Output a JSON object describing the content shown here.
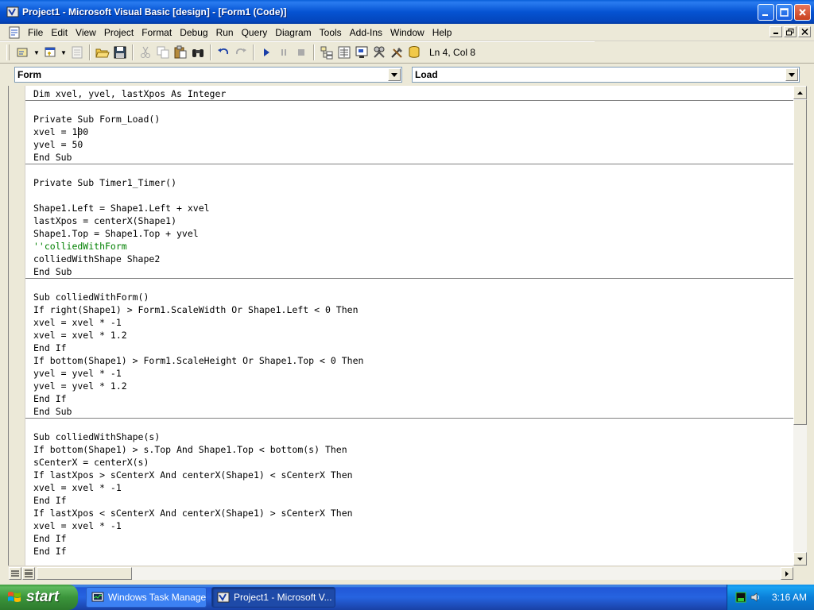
{
  "window": {
    "title": "Project1 - Microsoft Visual Basic [design] - [Form1 (Code)]"
  },
  "menu": {
    "items": [
      "File",
      "Edit",
      "View",
      "Project",
      "Format",
      "Debug",
      "Run",
      "Query",
      "Diagram",
      "Tools",
      "Add-Ins",
      "Window",
      "Help"
    ]
  },
  "toolbar": {
    "position_label": "Ln 4, Col 8"
  },
  "combos": {
    "object": "Form",
    "procedure": "Load"
  },
  "code": {
    "lines": [
      {
        "text": "Dim xvel, yvel, lastXpos As Integer",
        "comment": false
      },
      {
        "text": "",
        "comment": false
      },
      {
        "text": "Private Sub Form_Load()",
        "comment": false
      },
      {
        "text": "xvel = 100",
        "comment": false
      },
      {
        "text": "yvel = 50",
        "comment": false
      },
      {
        "text": "End Sub",
        "comment": false
      },
      {
        "text": "",
        "comment": false
      },
      {
        "text": "Private Sub Timer1_Timer()",
        "comment": false
      },
      {
        "text": "",
        "comment": false
      },
      {
        "text": "Shape1.Left = Shape1.Left + xvel",
        "comment": false
      },
      {
        "text": "lastXpos = centerX(Shape1)",
        "comment": false
      },
      {
        "text": "Shape1.Top = Shape1.Top + yvel",
        "comment": false
      },
      {
        "text": "''colliedWithForm",
        "comment": true
      },
      {
        "text": "colliedWithShape Shape2",
        "comment": false
      },
      {
        "text": "End Sub",
        "comment": false
      },
      {
        "text": "",
        "comment": false
      },
      {
        "text": "Sub colliedWithForm()",
        "comment": false
      },
      {
        "text": "If right(Shape1) > Form1.ScaleWidth Or Shape1.Left < 0 Then",
        "comment": false
      },
      {
        "text": "xvel = xvel * -1",
        "comment": false
      },
      {
        "text": "xvel = xvel * 1.2",
        "comment": false
      },
      {
        "text": "End If",
        "comment": false
      },
      {
        "text": "If bottom(Shape1) > Form1.ScaleHeight Or Shape1.Top < 0 Then",
        "comment": false
      },
      {
        "text": "yvel = yvel * -1",
        "comment": false
      },
      {
        "text": "yvel = yvel * 1.2",
        "comment": false
      },
      {
        "text": "End If",
        "comment": false
      },
      {
        "text": "End Sub",
        "comment": false
      },
      {
        "text": "",
        "comment": false
      },
      {
        "text": "Sub colliedWithShape(s)",
        "comment": false
      },
      {
        "text": "If bottom(Shape1) > s.Top And Shape1.Top < bottom(s) Then",
        "comment": false
      },
      {
        "text": "sCenterX = centerX(s)",
        "comment": false
      },
      {
        "text": "If lastXpos > sCenterX And centerX(Shape1) < sCenterX Then",
        "comment": false
      },
      {
        "text": "xvel = xvel * -1",
        "comment": false
      },
      {
        "text": "End If",
        "comment": false
      },
      {
        "text": "If lastXpos < sCenterX And centerX(Shape1) > sCenterX Then",
        "comment": false
      },
      {
        "text": "xvel = xvel * -1",
        "comment": false
      },
      {
        "text": "End If",
        "comment": false
      },
      {
        "text": "End If",
        "comment": false
      }
    ]
  },
  "taskbar": {
    "start_label": "start",
    "tasks": [
      {
        "label": "Windows Task Manager"
      },
      {
        "label": "Project1 - Microsoft V..."
      }
    ],
    "clock": "3:16 AM"
  }
}
